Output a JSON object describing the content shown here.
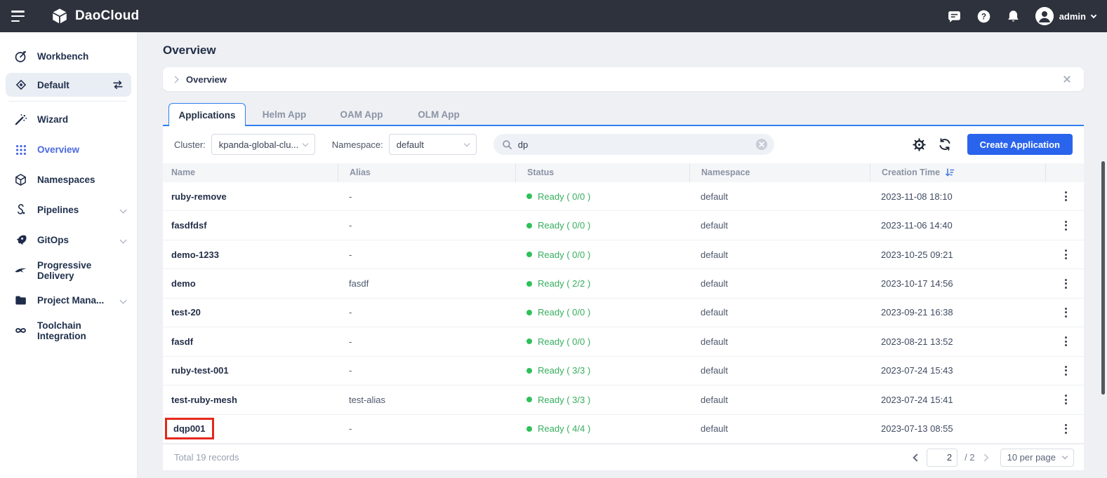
{
  "topbar": {
    "brand": "DaoCloud",
    "user": "admin"
  },
  "sidebar": {
    "items": [
      {
        "label": "Workbench",
        "icon": "workbench-icon"
      },
      {
        "label": "Default",
        "icon": "workspace-icon"
      },
      {
        "label": "Wizard",
        "icon": "wand-icon"
      },
      {
        "label": "Overview",
        "icon": "grid-icon"
      },
      {
        "label": "Namespaces",
        "icon": "cube-icon"
      },
      {
        "label": "Pipelines",
        "icon": "pipeline-icon"
      },
      {
        "label": "GitOps",
        "icon": "rocket-icon"
      },
      {
        "label": "Progressive Delivery",
        "icon": "bird-icon"
      },
      {
        "label": "Project Mana...",
        "icon": "folder-icon"
      },
      {
        "label": "Toolchain Integration",
        "icon": "infinity-icon"
      }
    ]
  },
  "page": {
    "title": "Overview"
  },
  "breadcrumb": {
    "item": "Overview"
  },
  "tabs": {
    "items": [
      "Applications",
      "Helm App",
      "OAM App",
      "OLM App"
    ],
    "active": "Applications"
  },
  "filters": {
    "cluster_label": "Cluster:",
    "cluster_value": "kpanda-global-clu...",
    "namespace_label": "Namespace:",
    "namespace_value": "default",
    "search_value": "dp"
  },
  "actions": {
    "create": "Create Application"
  },
  "table": {
    "headers": {
      "name": "Name",
      "alias": "Alias",
      "status": "Status",
      "namespace": "Namespace",
      "created": "Creation Time"
    },
    "rows": [
      {
        "name": "ruby-remove",
        "alias": "-",
        "status": "Ready ( 0/0 )",
        "namespace": "default",
        "created": "2023-11-08 18:10"
      },
      {
        "name": "fasdfdsf",
        "alias": "-",
        "status": "Ready ( 0/0 )",
        "namespace": "default",
        "created": "2023-11-06 14:40"
      },
      {
        "name": "demo-1233",
        "alias": "-",
        "status": "Ready ( 0/0 )",
        "namespace": "default",
        "created": "2023-10-25 09:21"
      },
      {
        "name": "demo",
        "alias": "fasdf",
        "status": "Ready ( 2/2 )",
        "namespace": "default",
        "created": "2023-10-17 14:56"
      },
      {
        "name": "test-20",
        "alias": "-",
        "status": "Ready ( 0/0 )",
        "namespace": "default",
        "created": "2023-09-21 16:38"
      },
      {
        "name": "fasdf",
        "alias": "-",
        "status": "Ready ( 0/0 )",
        "namespace": "default",
        "created": "2023-08-21 13:52"
      },
      {
        "name": "ruby-test-001",
        "alias": "-",
        "status": "Ready ( 3/3 )",
        "namespace": "default",
        "created": "2023-07-24 15:43"
      },
      {
        "name": "test-ruby-mesh",
        "alias": "test-alias",
        "status": "Ready ( 3/3 )",
        "namespace": "default",
        "created": "2023-07-24 15:41"
      },
      {
        "name": "dqp001",
        "alias": "-",
        "status": "Ready ( 4/4 )",
        "namespace": "default",
        "created": "2023-07-13 08:55"
      }
    ]
  },
  "footer": {
    "total": "Total 19 records",
    "page_value": "2",
    "page_total": "/ 2",
    "per_page": "10 per page"
  },
  "colors": {
    "topbar_bg": "#2d323d",
    "accent_blue": "#2a64ec",
    "link_blue": "#4a68e0",
    "status_green": "#2ec158",
    "highlight_red": "#e5281b"
  }
}
